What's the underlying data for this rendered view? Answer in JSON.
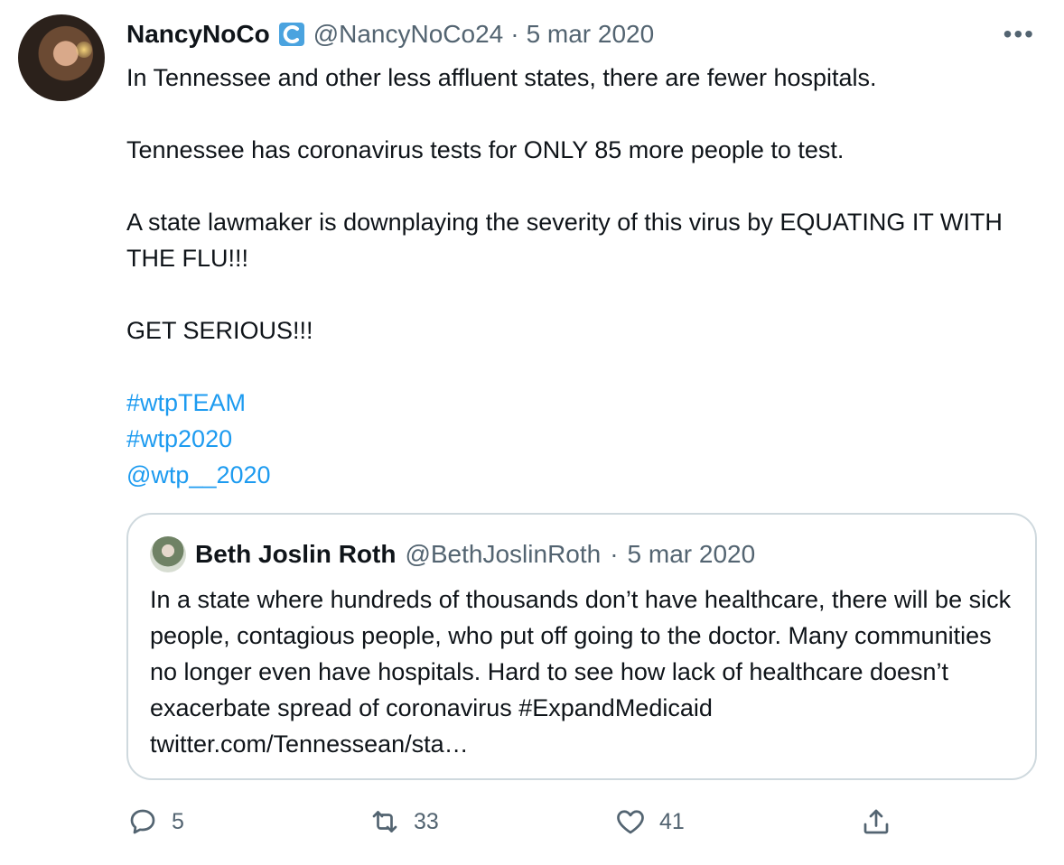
{
  "tweet": {
    "author": {
      "name": "NancyNoCo",
      "handle": "@NancyNoCo24",
      "date": "5 mar 2020",
      "separator": "·",
      "badge_icon": "wave-icon"
    },
    "more_label": "•••",
    "paragraphs": [
      "In Tennessee and other less affluent states, there are fewer hospitals.",
      "Tennessee has coronavirus tests for ONLY 85 more people to test.",
      "A state lawmaker is downplaying the severity of this virus by EQUATING IT WITH THE FLU!!!",
      "GET SERIOUS!!!"
    ],
    "tags": [
      "#wtpTEAM",
      "#wtp2020",
      "@wtp__2020"
    ]
  },
  "quoted": {
    "name": "Beth Joslin Roth",
    "handle": "@BethJoslinRoth",
    "date": "5 mar 2020",
    "separator": "·",
    "text": "In a state where hundreds of thousands don’t have healthcare, there will be sick people, contagious people, who put off going to the doctor. Many communities no longer even have hospitals. Hard to see how lack of healthcare doesn’t exacerbate spread of coronavirus #ExpandMedicaid twitter.com/Tennessean/sta…"
  },
  "actions": {
    "reply_count": "5",
    "retweet_count": "33",
    "like_count": "41"
  },
  "colors": {
    "link": "#1d9bf0",
    "muted": "#536471",
    "border": "#cfd9de"
  }
}
